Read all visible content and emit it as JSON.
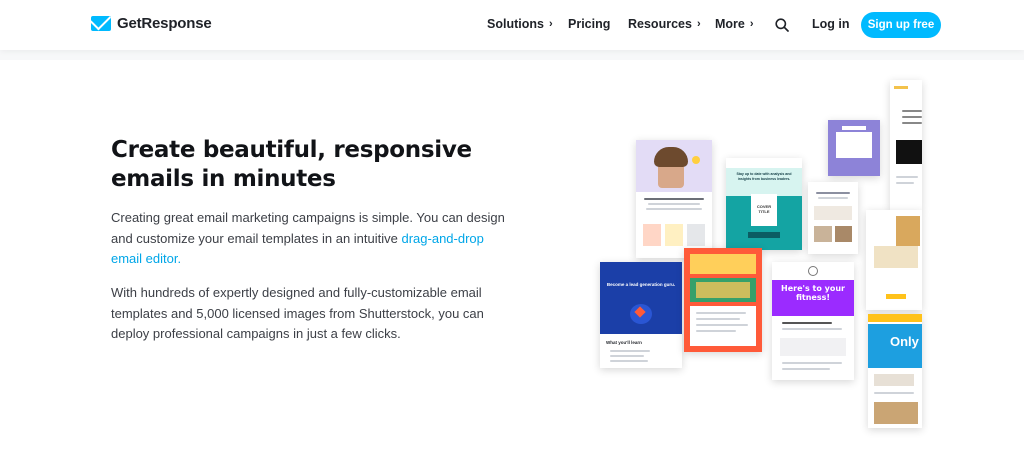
{
  "header": {
    "brand": "GetResponse",
    "nav": [
      {
        "label": "Solutions",
        "has_chevron": true
      },
      {
        "label": "Pricing",
        "has_chevron": false
      },
      {
        "label": "Resources",
        "has_chevron": true
      },
      {
        "label": "More",
        "has_chevron": true
      }
    ],
    "chevron": "›",
    "search_icon": "search-icon",
    "login": "Log in",
    "signup": "Sign up free"
  },
  "hero": {
    "title": "Create beautiful, responsive emails in minutes",
    "para1_text": "Creating great email marketing campaigns is simple. You can design and customize your email templates in an intuitive",
    "para1_link": "drag-and-drop email editor.",
    "para2": "With hundreds of expertly designed and fully-customizable email templates and 5,000 licensed images from Shutterstock, you can deploy professional campaigns in just a few clicks."
  },
  "templates": {
    "lead_gen_title": "Become a lead generation guru.",
    "lead_gen_learn": "What you'll learn",
    "business_title": "Stay up to date with analysis and insights from business leaders.",
    "cover_title": "COVER TITLE",
    "heres_text": "Here's to your fitness!",
    "only_text": "Only"
  },
  "colors": {
    "brand": "#00baff",
    "link": "#00a6e8",
    "title": "#111317",
    "body": "#3d4047",
    "navy": "#1b3fa8",
    "teal": "#14a4a3",
    "orange": "#ff5a39",
    "purple": "#9b2bff",
    "yellow": "#ffc21a"
  }
}
